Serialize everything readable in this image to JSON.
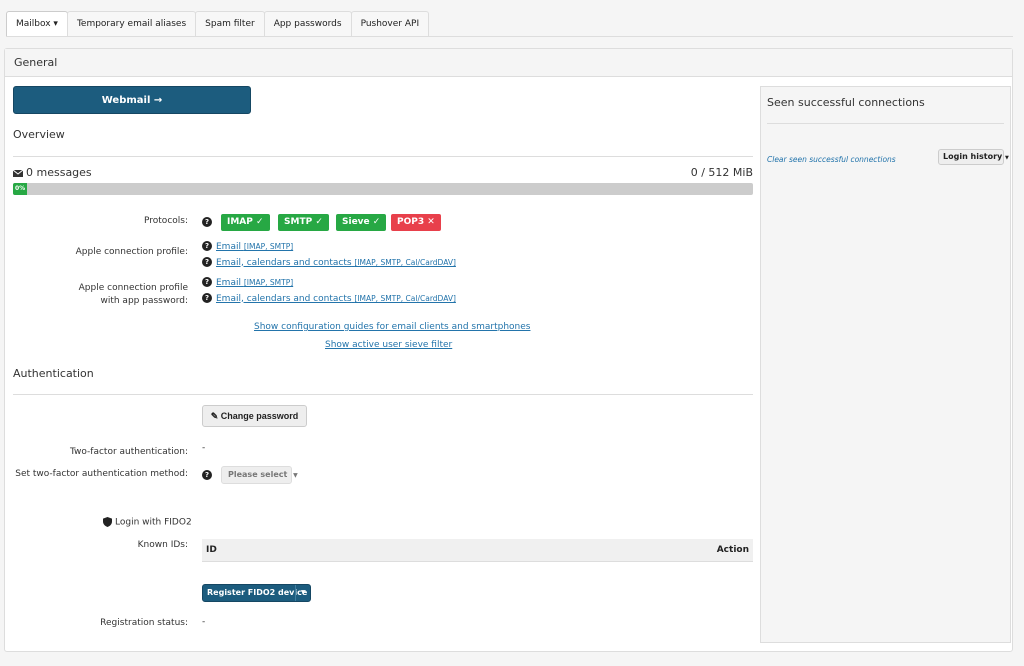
{
  "tabs": [
    {
      "label": "Mailbox ▾"
    },
    {
      "label": "Temporary email aliases"
    },
    {
      "label": "Spam filter"
    },
    {
      "label": "App passwords"
    },
    {
      "label": "Pushover API"
    }
  ],
  "panel": {
    "title": "General"
  },
  "webmail": {
    "label": "Webmail →"
  },
  "overview": {
    "title": "Overview",
    "messages": "0 messages",
    "quota": "0 / 512 MiB",
    "progress_label": "0%",
    "progress_percent": 0
  },
  "protocols": {
    "label": "Protocols:",
    "items": [
      {
        "name": "IMAP",
        "status": "✓"
      },
      {
        "name": "SMTP",
        "status": "✓"
      },
      {
        "name": "Sieve",
        "status": "✓"
      },
      {
        "name": "POP3",
        "status": "✕"
      }
    ]
  },
  "apple_profile": {
    "label": "Apple connection profile:",
    "links": [
      {
        "text": "Email",
        "detail": "[IMAP, SMTP]"
      },
      {
        "text": "Email, calendars and contacts",
        "detail": "[IMAP, SMTP, Cal/CardDAV]"
      }
    ]
  },
  "apple_profile_app": {
    "label_line1": "Apple connection profile",
    "label_line2": "with app password:",
    "links": [
      {
        "text": "Email",
        "detail": "[IMAP, SMTP]"
      },
      {
        "text": "Email, calendars and contacts",
        "detail": "[IMAP, SMTP, Cal/CardDAV]"
      }
    ]
  },
  "links": {
    "config_guides": "Show configuration guides for email clients and smartphones",
    "sieve_filter": "Show active user sieve filter"
  },
  "auth": {
    "title": "Authentication",
    "change_password": "Change password",
    "tfa_label": "Two-factor authentication:",
    "tfa_value": "-",
    "tfa_method_label": "Set two-factor authentication method:",
    "tfa_method_select": "Please select",
    "fido2_label": "Login with FIDO2",
    "known_ids_label": "Known IDs:",
    "table_col_id": "ID",
    "table_col_action": "Action",
    "register_fido2": "Register FIDO2 device",
    "registration_status_label": "Registration status:",
    "registration_status_value": "-"
  },
  "side": {
    "title": "Seen successful connections",
    "clear_link": "Clear seen successful connections",
    "login_history": "Login history"
  },
  "colors": {
    "primary": "#1c5c7e",
    "success": "#27a844",
    "danger": "#e8404b",
    "link": "#2374ab"
  }
}
